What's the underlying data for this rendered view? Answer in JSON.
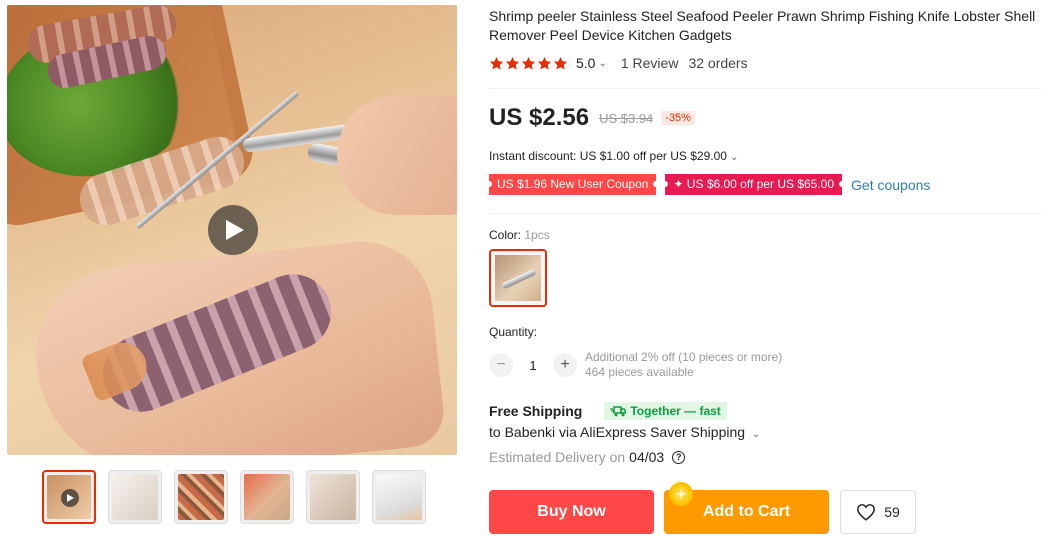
{
  "gallery": {
    "thumbnail_count": 6,
    "active_thumbnail": 1,
    "has_video": true
  },
  "product": {
    "title": "Shrimp peeler Stainless Steel Seafood Peeler Prawn Shrimp Fishing Knife Lobster Shell Remover Peel Device Kitchen Gadgets",
    "rating": "5.0",
    "rating_chevron": "⌄",
    "reviews": "1 Review",
    "orders": "32 orders"
  },
  "pricing": {
    "price": "US $2.56",
    "original_price": "US $3.94",
    "discount": "-35%",
    "instant_discount": "Instant discount: US $1.00 off per US $29.00",
    "coupon_new_user": "US $1.96 New User Coupon",
    "coupon_store": "✦ US $6.00 off per US $65.00",
    "get_coupons": "Get coupons"
  },
  "variant": {
    "color_label": "Color:",
    "color_value": "1pcs"
  },
  "quantity": {
    "label": "Quantity:",
    "value": "1",
    "minus": "−",
    "plus": "+",
    "additional": "Additional 2% off (10 pieces or more)",
    "available": "464 pieces available"
  },
  "shipping": {
    "free_shipping": "Free Shipping",
    "together_badge": "Together — fast",
    "route": "to Babenki via AliExpress Saver Shipping",
    "estimated_label": "Estimated Delivery on",
    "estimated_date": "04/03",
    "help": "?"
  },
  "actions": {
    "buy_now": "Buy Now",
    "add_to_cart": "Add to Cart",
    "wishlist_count": "59"
  },
  "colors": {
    "accent_red": "#ff4747",
    "coupon_pink": "#e81a52",
    "cart_orange": "#ff9900",
    "link_blue": "#2e7bb6",
    "together_green": "#0a9e3b",
    "star_red": "#e62e04"
  }
}
